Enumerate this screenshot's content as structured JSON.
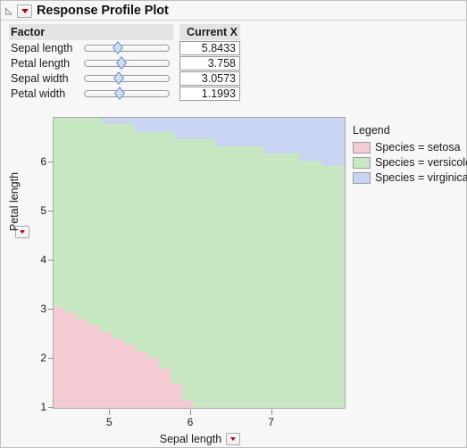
{
  "window": {
    "title": "Response Profile Plot",
    "disclosure_icon": "disclosure-triangle-icon",
    "menu_icon": "red-triangle-menu-icon"
  },
  "factor_table": {
    "headers": {
      "factor": "Factor",
      "slider": "",
      "current_x": "Current X"
    },
    "rows": [
      {
        "factor": "Sepal length",
        "current_x": "5.8433",
        "slider_pct": 40
      },
      {
        "factor": "Petal length",
        "current_x": "3.758",
        "slider_pct": 44
      },
      {
        "factor": "Sepal width",
        "current_x": "3.0573",
        "slider_pct": 41
      },
      {
        "factor": "Petal width",
        "current_x": "1.1993",
        "slider_pct": 42
      }
    ]
  },
  "legend": {
    "title": "Legend",
    "items": [
      {
        "label": "Species = setosa",
        "color": "#f5cbd4"
      },
      {
        "label": "Species = versicolor",
        "color": "#c8e8c4"
      },
      {
        "label": "Species = virginica",
        "color": "#c9d3f2"
      }
    ]
  },
  "chart_data": {
    "type": "heatmap",
    "title": "Response Profile Plot",
    "xlabel": "Sepal length",
    "ylabel": "Petal length",
    "xlim": [
      4.3,
      7.9
    ],
    "ylim": [
      1.0,
      6.9
    ],
    "xticks": [
      5,
      6,
      7
    ],
    "yticks": [
      1,
      2,
      3,
      4,
      5,
      6
    ],
    "grid": false,
    "legend_position": "right",
    "regions": [
      {
        "name": "Species = setosa",
        "color": "#f5cbd4",
        "description": "Lower-left wedge; boundary with versicolor descends in steps from (x=4.3, y=3.05) to (x=6.0, y=1.0)",
        "boundary": [
          [
            4.3,
            3.05
          ],
          [
            4.44,
            3.05
          ],
          [
            4.44,
            2.93
          ],
          [
            4.59,
            2.93
          ],
          [
            4.59,
            2.8
          ],
          [
            4.73,
            2.8
          ],
          [
            4.73,
            2.67
          ],
          [
            4.88,
            2.67
          ],
          [
            4.88,
            2.54
          ],
          [
            5.02,
            2.54
          ],
          [
            5.02,
            2.41
          ],
          [
            5.17,
            2.41
          ],
          [
            5.17,
            2.28
          ],
          [
            5.31,
            2.28
          ],
          [
            5.31,
            2.15
          ],
          [
            5.46,
            2.15
          ],
          [
            5.46,
            2.02
          ],
          [
            5.6,
            2.02
          ],
          [
            5.6,
            1.8
          ],
          [
            5.75,
            1.8
          ],
          [
            5.75,
            1.5
          ],
          [
            5.89,
            1.5
          ],
          [
            5.89,
            1.15
          ],
          [
            6.03,
            1.15
          ],
          [
            6.03,
            1.0
          ]
        ]
      },
      {
        "name": "Species = versicolor",
        "color": "#c8e8c4",
        "description": "Central band spanning most of the plot between the setosa wedge and the virginica band at top"
      },
      {
        "name": "Species = virginica",
        "color": "#c9d3f2",
        "description": "Upper-right band; boundary with versicolor descends in steps from (x=4.9, y=6.9) to (x=7.9, y=5.95)",
        "boundary": [
          [
            4.3,
            6.9
          ],
          [
            4.9,
            6.9
          ],
          [
            4.9,
            6.78
          ],
          [
            5.3,
            6.78
          ],
          [
            5.3,
            6.62
          ],
          [
            5.8,
            6.62
          ],
          [
            5.8,
            6.47
          ],
          [
            6.3,
            6.47
          ],
          [
            6.3,
            6.32
          ],
          [
            6.9,
            6.32
          ],
          [
            6.9,
            6.17
          ],
          [
            7.35,
            6.17
          ],
          [
            7.35,
            6.02
          ],
          [
            7.62,
            6.02
          ],
          [
            7.62,
            5.92
          ],
          [
            7.9,
            5.92
          ]
        ]
      }
    ]
  }
}
